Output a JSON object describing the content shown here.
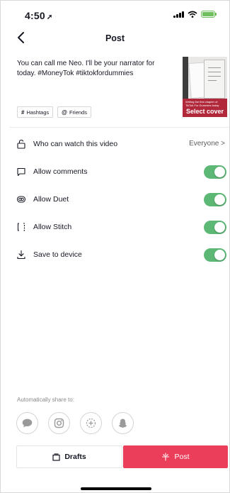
{
  "status_bar": {
    "time": "4:50",
    "location_symbol": "➚"
  },
  "nav": {
    "back_icon": "chevron-left-icon",
    "title": "Post"
  },
  "caption": {
    "text": "You can call me Neo. I'll be your narrator for today. #MoneyTok #tiktokfordummies"
  },
  "cover": {
    "small_text": "Writing the first chapter of TikTok For Dummies today",
    "select_label": "Select cover"
  },
  "chips": [
    {
      "symbol": "#",
      "label": "Hashtags"
    },
    {
      "symbol": "@",
      "label": "Friends"
    }
  ],
  "settings": {
    "who_can_watch": {
      "label": "Who can watch this video",
      "value": "Everyone",
      "chevron": ">"
    },
    "allow_comments": {
      "label": "Allow comments",
      "on": true
    },
    "allow_duet": {
      "label": "Allow Duet",
      "on": true
    },
    "allow_stitch": {
      "label": "Allow Stitch",
      "on": true
    },
    "save_to_device": {
      "label": "Save to device",
      "on": true
    }
  },
  "share": {
    "label": "Automatically share to:",
    "targets": [
      "messages-icon",
      "instagram-icon",
      "add-icon",
      "snapchat-icon"
    ]
  },
  "buttons": {
    "drafts_label": "Drafts",
    "post_label": "Post"
  },
  "colors": {
    "accent": "#ea3e5a",
    "toggle_on": "#5db876"
  }
}
